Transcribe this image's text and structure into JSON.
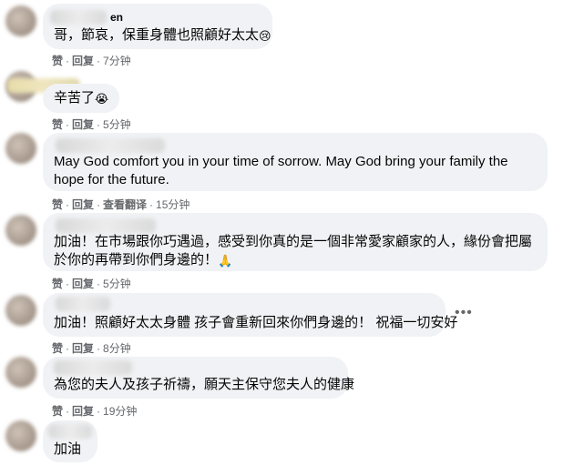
{
  "comments": [
    {
      "name": "en",
      "text": "哥，節哀，保重身體也照顧好太太",
      "emoji": "😢",
      "like": "赞",
      "reply": "回复",
      "time": "7分钟"
    },
    {
      "text": "辛苦了",
      "emoji": "😭",
      "like": "赞",
      "reply": "回复",
      "time": "5分钟"
    },
    {
      "text": "May God comfort you in your time of sorrow. May God bring your family the hope for the future.",
      "like": "赞",
      "reply": "回复",
      "translate": "查看翻译",
      "time": "15分钟"
    },
    {
      "text": "加油！在市場跟你巧遇過，感受到你真的是一個非常愛家顧家的人，緣份會把屬於你的再帶到你們身邊的！",
      "emoji": "🙏",
      "like": "赞",
      "reply": "回复",
      "time": "5分钟"
    },
    {
      "text": "加油！照顧好太太身體 孩子會重新回來你們身邊的！ 祝福一切安好",
      "like": "赞",
      "reply": "回复",
      "time": "8分钟"
    },
    {
      "text": "為您的夫人及孩子祈禱，願天主保守您夫人的健康",
      "like": "赞",
      "reply": "回复",
      "time": "19分钟"
    },
    {
      "text": "加油"
    }
  ],
  "more_icon": "more-dots-icon",
  "colors": {
    "bubble": "#f0f2f5",
    "meta": "#65676b",
    "text": "#050505"
  }
}
